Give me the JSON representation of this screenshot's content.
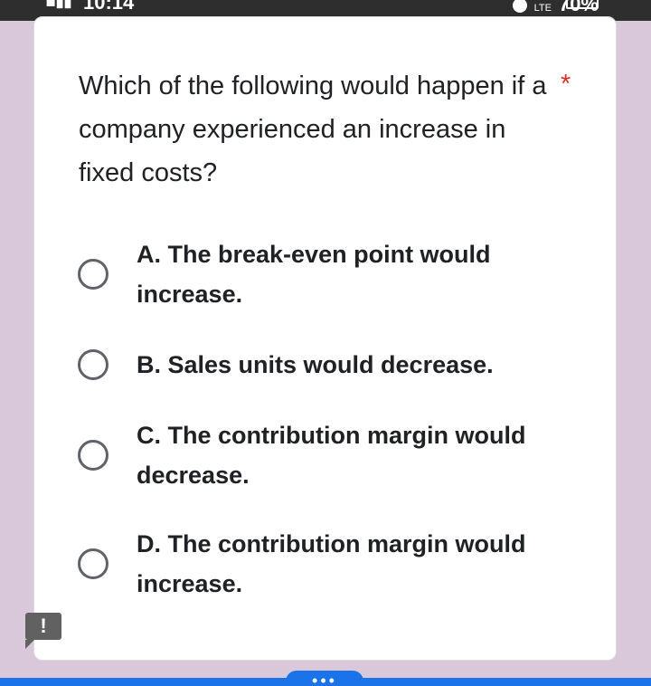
{
  "status_bar": {
    "signal": "▪▮▮",
    "time": "10:14",
    "network": "LTE",
    "battery_percent": "70%"
  },
  "question": {
    "text": "Which of the following would happen if a company experienced an increase in fixed costs?",
    "required_marker": "*"
  },
  "options": [
    {
      "label": "A. The break-even point would increase.",
      "selected": false
    },
    {
      "label": "B. Sales units would decrease.",
      "selected": false
    },
    {
      "label": "C. The contribution margin would decrease.",
      "selected": false
    },
    {
      "label": "D. The contribution margin would increase.",
      "selected": false
    }
  ],
  "alert_icon": {
    "symbol": "!",
    "icon": "report-alert-icon"
  },
  "bottom_nav": {
    "more_symbol": "•••",
    "accent_color": "#1a73e8"
  }
}
